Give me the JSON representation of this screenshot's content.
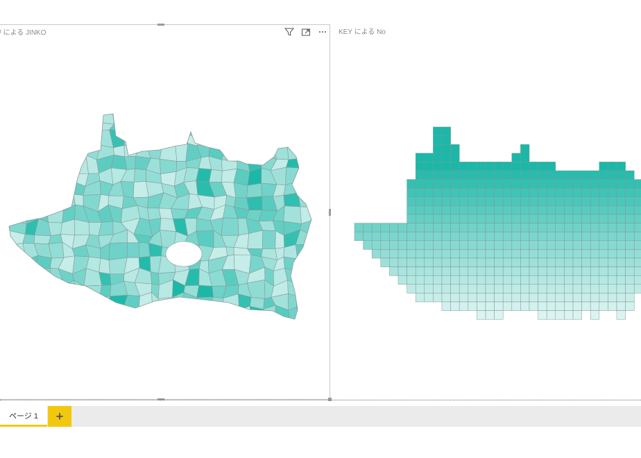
{
  "visuals": {
    "left": {
      "title": "KEY による JINKO",
      "title_visible": "/ による JINKO"
    },
    "right": {
      "title": "KEY による No"
    }
  },
  "header_icons": {
    "filter": "filter-icon",
    "focus": "focus-mode-icon",
    "more": "more-options-icon"
  },
  "colors": {
    "accent": "#1ab8a8",
    "light": "#e6f7f5",
    "tab_accent": "#f2c80f"
  },
  "pages": {
    "tabs": [
      {
        "label": "ページ 1"
      }
    ],
    "add_label": "+"
  }
}
